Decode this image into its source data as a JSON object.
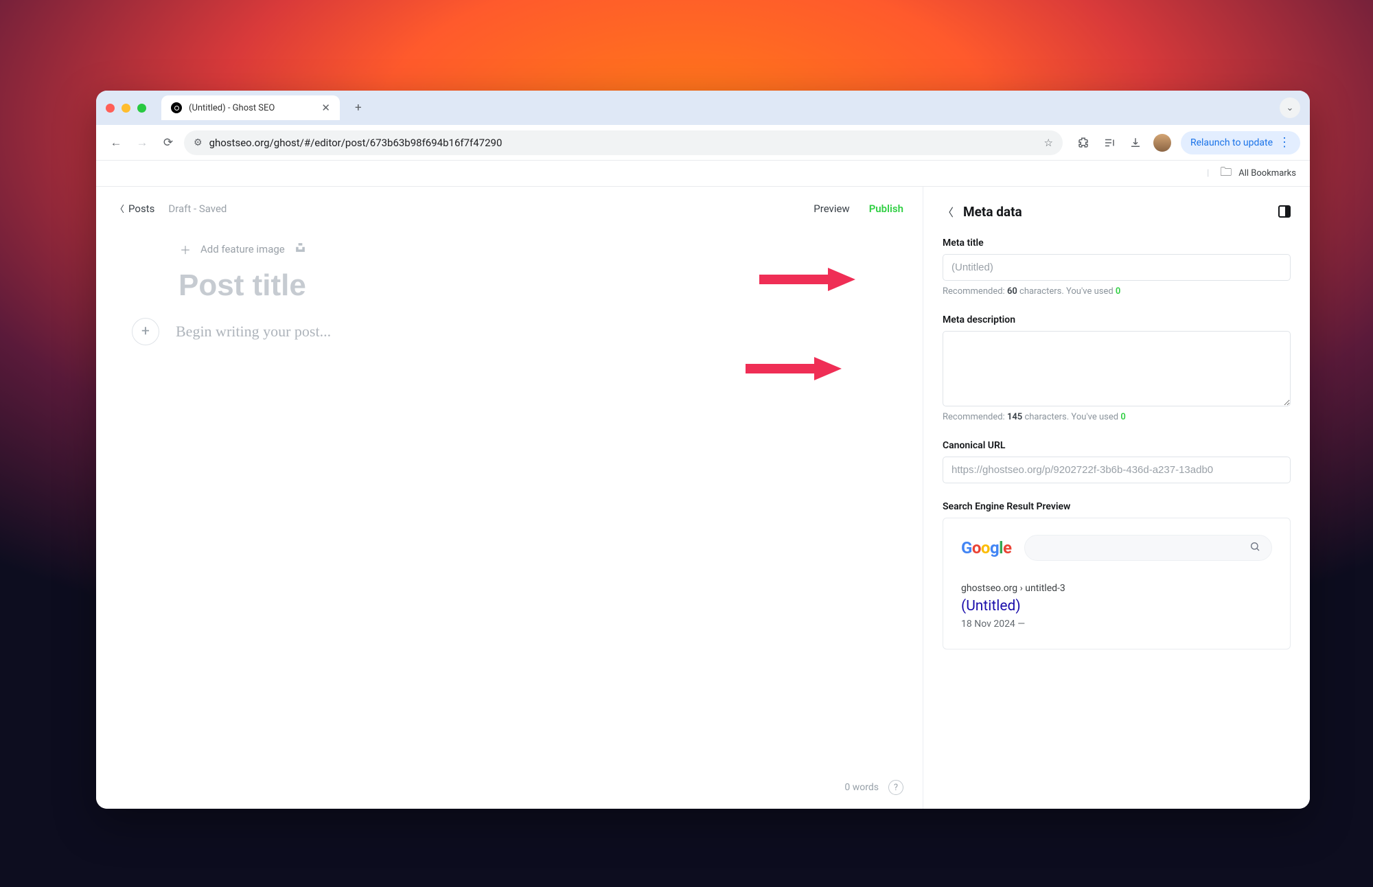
{
  "browser": {
    "tab_title": "(Untitled) - Ghost SEO",
    "url": "ghostseo.org/ghost/#/editor/post/673b63b98f694b16f7f47290",
    "relaunch": "Relaunch to update",
    "all_bookmarks": "All Bookmarks"
  },
  "editor": {
    "posts_link": "Posts",
    "status": "Draft - Saved",
    "preview": "Preview",
    "publish": "Publish",
    "add_feature_image": "Add feature image",
    "title_placeholder": "Post title",
    "body_placeholder": "Begin writing your post...",
    "word_count": "0 words"
  },
  "meta": {
    "panel_title": "Meta data",
    "title_label": "Meta title",
    "title_placeholder": "(Untitled)",
    "title_hint_prefix": "Recommended: ",
    "title_hint_num": "60",
    "title_hint_mid": " characters. You've used ",
    "title_hint_used": "0",
    "desc_label": "Meta description",
    "desc_hint_prefix": "Recommended: ",
    "desc_hint_num": "145",
    "desc_hint_mid": " characters. You've used ",
    "desc_hint_used": "0",
    "canonical_label": "Canonical URL",
    "canonical_placeholder": "https://ghostseo.org/p/9202722f-3b6b-436d-a237-13adb0",
    "serp_label": "Search Engine Result Preview",
    "serp_url": "ghostseo.org › untitled-3",
    "serp_title": "(Untitled)",
    "serp_desc": "18 Nov 2024 —"
  }
}
